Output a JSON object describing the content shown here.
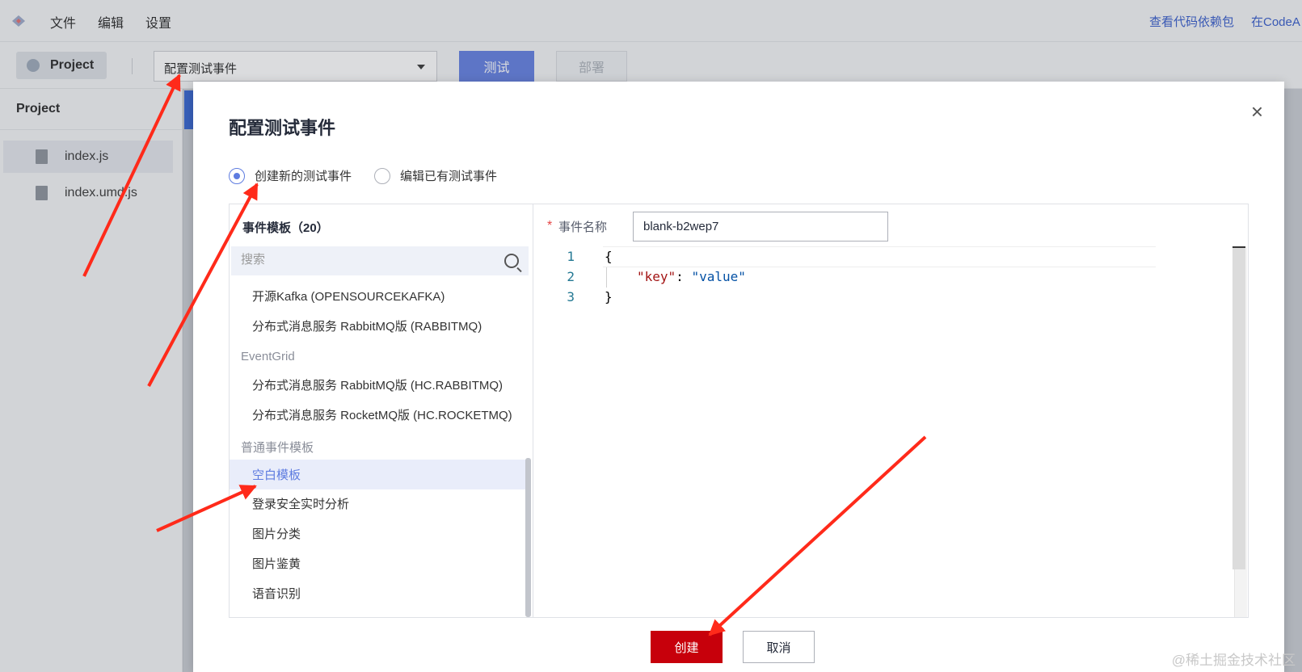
{
  "menubar": {
    "items": [
      "文件",
      "编辑",
      "设置"
    ],
    "links": [
      "查看代码依赖包",
      "在CodeA"
    ]
  },
  "toolbar": {
    "project_label": "Project",
    "event_select_value": "配置测试事件",
    "test_label": "测试",
    "deploy_label": "部署"
  },
  "sidebar": {
    "title": "Project",
    "files": [
      "index.js",
      "index.umd.js"
    ]
  },
  "modal": {
    "title": "配置测试事件",
    "close_icon": "×",
    "radio_create": "创建新的测试事件",
    "radio_edit": "编辑已有测试事件",
    "template_title": "事件模板（20）",
    "search_placeholder": "搜索",
    "tree": {
      "item_kafka": "开源Kafka (OPENSOURCEKAFKA)",
      "item_rabbit": "分布式消息服务 RabbitMQ版 (RABBITMQ)",
      "group_eventgrid": "EventGrid",
      "item_hc_rabbit": "分布式消息服务 RabbitMQ版 (HC.RABBITMQ)",
      "item_hc_rocket": "分布式消息服务 RocketMQ版 (HC.ROCKETMQ)",
      "group_common": "普通事件模板",
      "item_blank": "空白模板",
      "item_login": "登录安全实时分析",
      "item_img_class": "图片分类",
      "item_img_porn": "图片鉴黄",
      "item_voice": "语音识别"
    },
    "event_name_label": "事件名称",
    "event_name_value": "blank-b2wep7",
    "code_lines": [
      {
        "num": "1",
        "text": "{"
      },
      {
        "num": "2",
        "key": "\"key\"",
        "sep": ": ",
        "val": "\"value\""
      },
      {
        "num": "3",
        "text": "}"
      }
    ],
    "create_label": "创建",
    "cancel_label": "取消"
  },
  "watermark": "@稀土掘金技术社区",
  "colors": {
    "primary": "#5e7ce0",
    "danger": "#c7000b",
    "arrow": "#ff2a1a",
    "link": "#2f56c9"
  }
}
